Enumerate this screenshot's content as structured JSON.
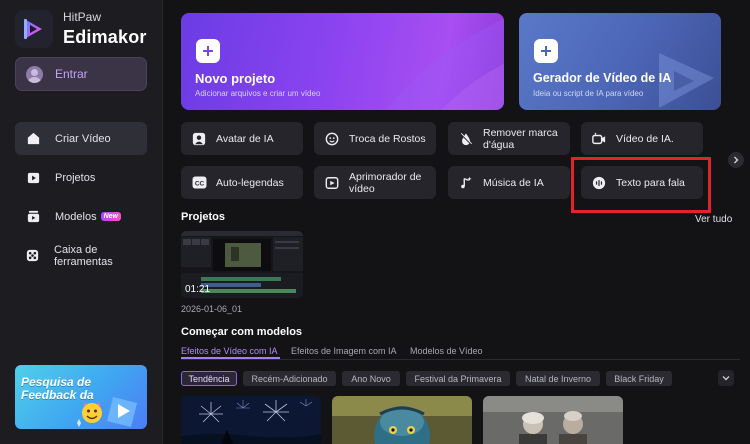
{
  "brand": {
    "line1": "HitPaw",
    "line2": "Edimakor"
  },
  "login": {
    "label": "Entrar"
  },
  "nav": [
    {
      "label": "Criar Vídeo",
      "icon": "home-icon"
    },
    {
      "label": "Projetos",
      "icon": "folder-icon"
    },
    {
      "label": "Modelos",
      "icon": "templates-icon",
      "badge": "New"
    },
    {
      "label": "Caixa de ferramentas",
      "icon": "toolbox-icon"
    }
  ],
  "promo": {
    "text": "Pesquisa de Feedback da"
  },
  "cards": {
    "new_project": {
      "title": "Novo projeto",
      "subtitle": "Adicionar arquivos e criar um vídeo"
    },
    "ai_generator": {
      "title": "Gerador de Vídeo de IA",
      "subtitle": "Ideia ou script de IA para vídeo"
    }
  },
  "tools": [
    {
      "label": "Avatar de IA",
      "icon": "avatar-icon"
    },
    {
      "label": "Troca de Rostos",
      "icon": "face-swap-icon"
    },
    {
      "label": "Remover marca d'água",
      "icon": "watermark-remove-icon"
    },
    {
      "label": "Vídeo de IA.",
      "icon": "ai-video-icon"
    },
    {
      "label": "Auto-legendas",
      "icon": "captions-icon"
    },
    {
      "label": "Aprimorador de vídeo",
      "icon": "enhancer-icon"
    },
    {
      "label": "Música de IA",
      "icon": "music-icon"
    },
    {
      "label": "Texto para fala",
      "icon": "text-to-speech-icon"
    }
  ],
  "projects": {
    "title": "Projetos",
    "view_all": "Ver tudo",
    "items": [
      {
        "duration": "01:21",
        "name": "2026-01-06_01"
      }
    ]
  },
  "templates": {
    "title": "Começar com modelos",
    "tabs": [
      "Efeitos de Vídeo com IA",
      "Efeitos de Imagem com IA",
      "Modelos de Vídeo"
    ],
    "chips": [
      "Tendência",
      "Recém-Adicionado",
      "Ano Novo",
      "Festival da Primavera",
      "Natal de Inverno",
      "Black Friday"
    ]
  },
  "colors": {
    "accent": "#a77ef5",
    "highlight_box": "#e0242d"
  }
}
